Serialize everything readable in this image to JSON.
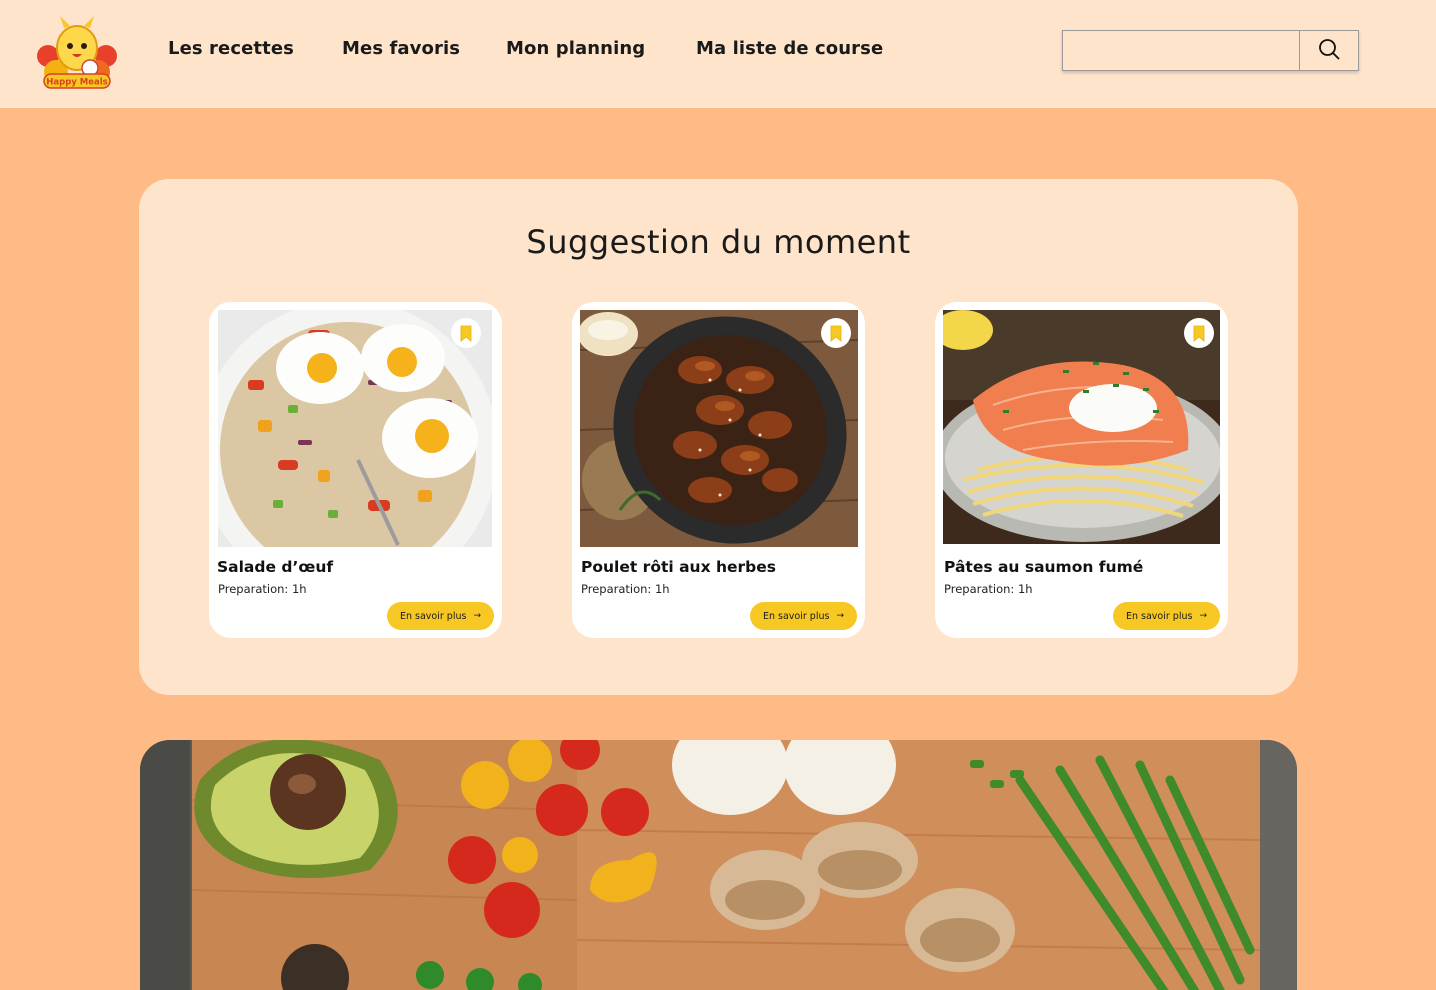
{
  "header": {
    "logo_text": "Happy Meals",
    "nav": [
      {
        "label": "Les recettes"
      },
      {
        "label": "Mes favoris"
      },
      {
        "label": "Mon planning"
      },
      {
        "label": "Ma liste de course"
      }
    ],
    "search": {
      "placeholder": "",
      "value": "",
      "icon": "search-icon"
    }
  },
  "suggestions": {
    "title": "Suggestion du moment",
    "cards": [
      {
        "title": "Salade d’œuf",
        "prep": "Preparation: 1h",
        "button": "En savoir plus",
        "bookmark_icon": "bookmark-icon",
        "image": "fried-eggs-quinoa-salad"
      },
      {
        "title": "Poulet rôti aux herbes",
        "prep": "Preparation: 1h",
        "button": "En savoir plus",
        "bookmark_icon": "bookmark-icon",
        "image": "glazed-roast-chicken-wings"
      },
      {
        "title": "Pâtes au saumon fumé",
        "prep": "Preparation: 1h",
        "button": "En savoir plus",
        "bookmark_icon": "bookmark-icon",
        "image": "smoked-salmon-pasta"
      }
    ]
  },
  "hero": {
    "image": "vegetables-on-cutting-board"
  },
  "colors": {
    "page_background": "#ffbb85",
    "header_background": "#ffe4cc",
    "panel_background": "#ffe4cc",
    "button_yellow": "#f7c824",
    "bookmark_yellow": "#f7c824"
  }
}
